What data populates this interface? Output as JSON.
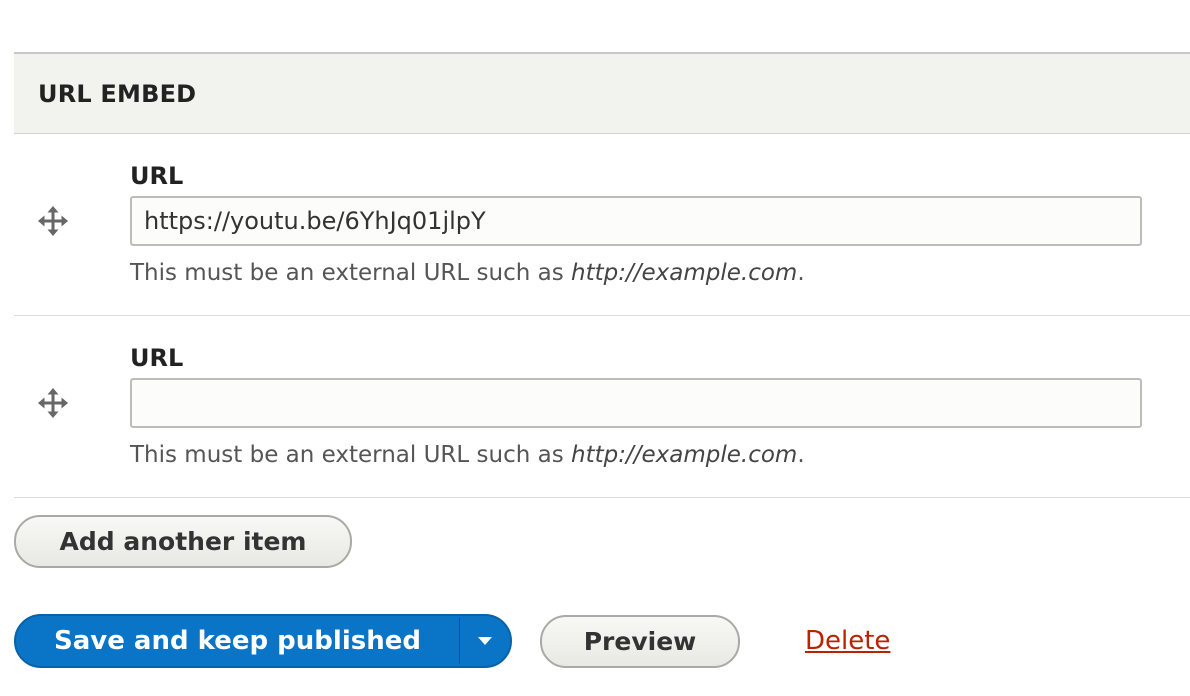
{
  "field": {
    "title": "URL EMBED"
  },
  "items": [
    {
      "label": "URL",
      "value": "https://youtu.be/6YhJq01jlpY",
      "placeholder": "",
      "help_prefix": "This must be an external URL such as ",
      "help_example": "http://example.com",
      "help_suffix": "."
    },
    {
      "label": "URL",
      "value": "",
      "placeholder": "",
      "help_prefix": "This must be an external URL such as ",
      "help_example": "http://example.com",
      "help_suffix": "."
    }
  ],
  "actions": {
    "add_another_label": "Add another item",
    "save_label": "Save and keep published",
    "preview_label": "Preview",
    "delete_label": "Delete"
  },
  "icons": {
    "drag": "move-arrows-icon",
    "dropdown": "chevron-down-icon"
  },
  "colors": {
    "primary": "#0a74c6",
    "danger_link": "#bb2200"
  }
}
